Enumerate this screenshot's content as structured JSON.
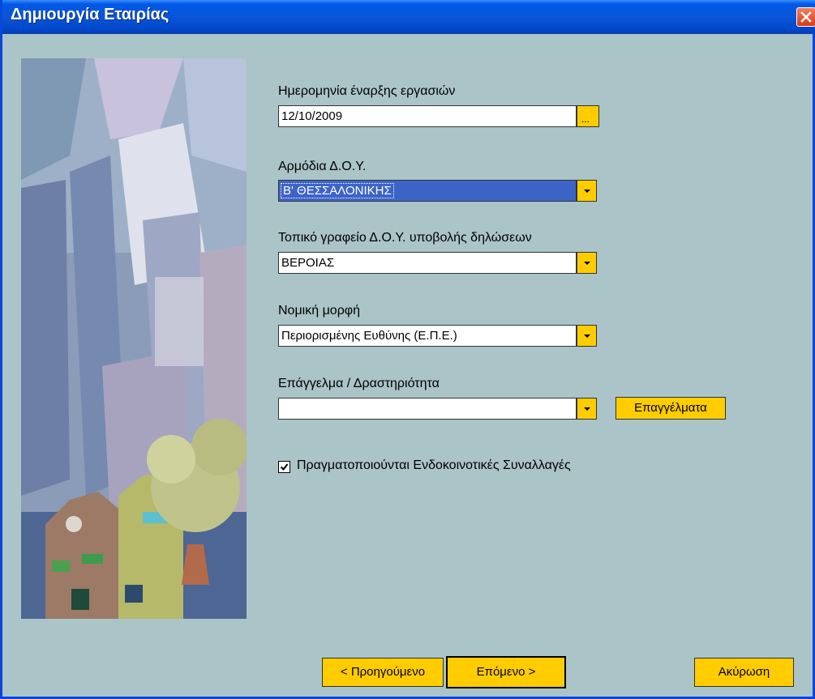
{
  "window": {
    "title": "Δημιουργία Εταιρίας",
    "close_icon": "close-icon"
  },
  "form": {
    "start_date": {
      "label": "Ημερομηνία έναρξης εργασιών",
      "value": "12/10/2009",
      "picker_label": "..."
    },
    "tax_office": {
      "label": "Αρμόδια Δ.Ο.Υ.",
      "value": "Β' ΘΕΣΣΑΛΟΝΙΚΗΣ"
    },
    "local_office": {
      "label": "Τοπικό γραφείο Δ.Ο.Υ. υποβολής δηλώσεων",
      "value": "ΒΕΡΟΙΑΣ"
    },
    "legal_form": {
      "label": "Νομική μορφή",
      "value": "Περιορισμένης Ευθύνης (Ε.Π.Ε.)"
    },
    "profession": {
      "label": "Επάγγελμα / Δραστηριότητα",
      "value": "",
      "button_label": "Επαγγέλματα"
    },
    "intra_community": {
      "label": "Πραγματοποιούνται Ενδοκοινοτικές Συναλλαγές",
      "checked": true
    }
  },
  "buttons": {
    "previous": "< Προηγούμενο",
    "next": "Επόμενο >",
    "cancel": "Ακύρωση"
  },
  "colors": {
    "titlebar": "#0a55d8",
    "dialog_bg": "#aac4c8",
    "button_yellow": "#ffcc00",
    "selection_blue": "#3c64c8"
  }
}
